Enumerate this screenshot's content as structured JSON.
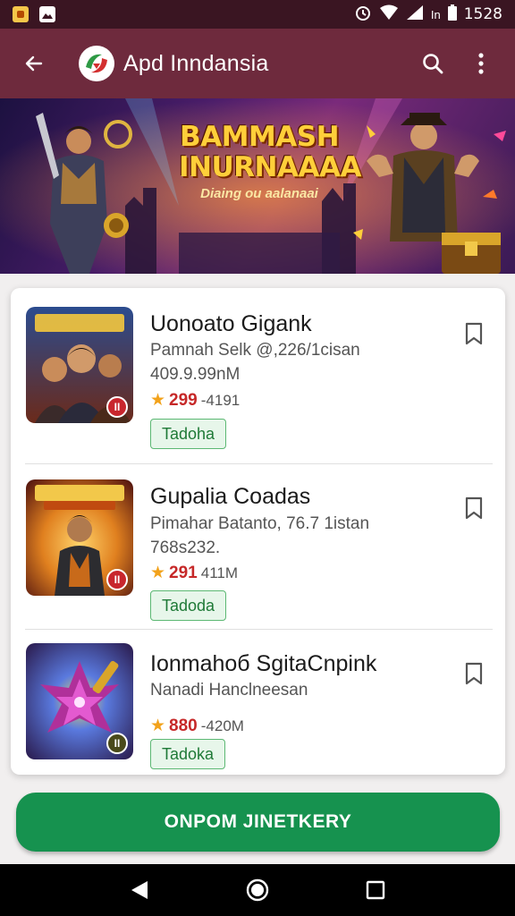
{
  "status_bar": {
    "time": "1528",
    "left_icons": [
      "app-notification-icon",
      "photo-notification-icon"
    ],
    "right_icons": [
      "alarm-icon",
      "wifi-icon",
      "signal-icon",
      "battery-icon"
    ],
    "network_label": "In"
  },
  "app_bar": {
    "title": "Apd Inndansia",
    "back_icon": "arrow-left-icon",
    "search_icon": "search-icon",
    "menu_icon": "more-vertical-icon"
  },
  "banner": {
    "title_line1": "BAMMASH",
    "title_line2": "INURNAAAA",
    "subtitle": "Diaing ou aalanaai"
  },
  "apps": [
    {
      "title": "Uonoato Gigank",
      "subtitle": "Pamnah Selk @,226/1cisan",
      "meta": "409.9.99nM",
      "rating": "299",
      "rating_extra": "-4191",
      "tag": "Tadoha",
      "badge": "II",
      "colors": {
        "top": "#2b4c8f",
        "bottom": "#6b2a1a"
      }
    },
    {
      "title": "Gupalia Coadas",
      "subtitle": "Pimahar Batanto, 76.7 1istan",
      "meta": "768s232.",
      "rating": "291",
      "rating_extra": "411M",
      "tag": "Tadoda",
      "badge": "II",
      "colors": {
        "top": "#e0801f",
        "bottom": "#5a1a10"
      }
    },
    {
      "title": "Ionmahoб SgitaCnpink",
      "subtitle": "Nanadi Hanclneesan",
      "meta": "",
      "rating": "880",
      "rating_extra": "-420M",
      "tag": "Tadoka",
      "badge": "II",
      "colors": {
        "top": "#2a3a8c",
        "bottom": "#6b1f5a"
      }
    }
  ],
  "primary_button": {
    "label": "ONPOM JINETKERY"
  },
  "nav": {
    "back": "back-triangle-icon",
    "home": "home-circle-icon",
    "recents": "recents-square-icon"
  },
  "colors": {
    "app_bar": "#6e2a3d",
    "status_bar": "#3a1522",
    "accent_green": "#16924f",
    "rating_red": "#c62828",
    "star": "#f2a21b"
  }
}
